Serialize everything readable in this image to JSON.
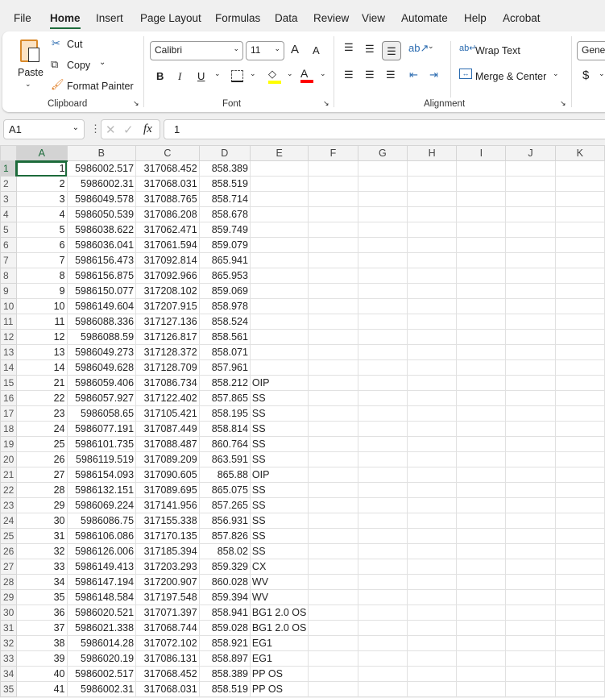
{
  "menu_tabs": [
    "File",
    "Home",
    "Insert",
    "Page Layout",
    "Formulas",
    "Data",
    "Review",
    "View",
    "Automate",
    "Help",
    "Acrobat"
  ],
  "active_tab": "Home",
  "clipboard": {
    "paste": "Paste",
    "cut": "Cut",
    "copy": "Copy",
    "format_painter": "Format Painter",
    "label": "Clipboard"
  },
  "font": {
    "name": "Calibri",
    "size": "11",
    "bold": "B",
    "italic": "I",
    "underline": "U",
    "label": "Font",
    "font_color_letter": "A",
    "grow": "A",
    "shrink": "A"
  },
  "alignment": {
    "wrap_text": "Wrap Text",
    "merge_center": "Merge & Center",
    "label": "Alignment"
  },
  "number": {
    "format": "Gener",
    "currency": "$"
  },
  "colors": {
    "accent": "#1d6b3b",
    "highlight": "#ffff00",
    "font_color": "#ff0000"
  },
  "formula_bar": {
    "name_box": "A1",
    "fx": "fx",
    "value": "1"
  },
  "columns": [
    "A",
    "B",
    "C",
    "D",
    "E",
    "F",
    "G",
    "H",
    "I",
    "J",
    "K"
  ],
  "rows": [
    [
      "1",
      "5986002.517",
      "317068.452",
      "858.389",
      ""
    ],
    [
      "2",
      "5986002.31",
      "317068.031",
      "858.519",
      ""
    ],
    [
      "3",
      "5986049.578",
      "317088.765",
      "858.714",
      ""
    ],
    [
      "4",
      "5986050.539",
      "317086.208",
      "858.678",
      ""
    ],
    [
      "5",
      "5986038.622",
      "317062.471",
      "859.749",
      ""
    ],
    [
      "6",
      "5986036.041",
      "317061.594",
      "859.079",
      ""
    ],
    [
      "7",
      "5986156.473",
      "317092.814",
      "865.941",
      ""
    ],
    [
      "8",
      "5986156.875",
      "317092.966",
      "865.953",
      ""
    ],
    [
      "9",
      "5986150.077",
      "317208.102",
      "859.069",
      ""
    ],
    [
      "10",
      "5986149.604",
      "317207.915",
      "858.978",
      ""
    ],
    [
      "11",
      "5986088.336",
      "317127.136",
      "858.524",
      ""
    ],
    [
      "12",
      "5986088.59",
      "317126.817",
      "858.561",
      ""
    ],
    [
      "13",
      "5986049.273",
      "317128.372",
      "858.071",
      ""
    ],
    [
      "14",
      "5986049.628",
      "317128.709",
      "857.961",
      ""
    ],
    [
      "21",
      "5986059.406",
      "317086.734",
      "858.212",
      "OIP"
    ],
    [
      "22",
      "5986057.927",
      "317122.402",
      "857.865",
      "SS"
    ],
    [
      "23",
      "5986058.65",
      "317105.421",
      "858.195",
      "SS"
    ],
    [
      "24",
      "5986077.191",
      "317087.449",
      "858.814",
      "SS"
    ],
    [
      "25",
      "5986101.735",
      "317088.487",
      "860.764",
      "SS"
    ],
    [
      "26",
      "5986119.519",
      "317089.209",
      "863.591",
      "SS"
    ],
    [
      "27",
      "5986154.093",
      "317090.605",
      "865.88",
      "OIP"
    ],
    [
      "28",
      "5986132.151",
      "317089.695",
      "865.075",
      "SS"
    ],
    [
      "29",
      "5986069.224",
      "317141.956",
      "857.265",
      "SS"
    ],
    [
      "30",
      "5986086.75",
      "317155.338",
      "856.931",
      "SS"
    ],
    [
      "31",
      "5986106.086",
      "317170.135",
      "857.826",
      "SS"
    ],
    [
      "32",
      "5986126.006",
      "317185.394",
      "858.02",
      "SS"
    ],
    [
      "33",
      "5986149.413",
      "317203.293",
      "859.329",
      "CX"
    ],
    [
      "34",
      "5986147.194",
      "317200.907",
      "860.028",
      "WV"
    ],
    [
      "35",
      "5986148.584",
      "317197.548",
      "859.394",
      "WV"
    ],
    [
      "36",
      "5986020.521",
      "317071.397",
      "858.941",
      "BG1 2.0 OS"
    ],
    [
      "37",
      "5986021.338",
      "317068.744",
      "859.028",
      "BG1 2.0 OS"
    ],
    [
      "38",
      "5986014.28",
      "317072.102",
      "858.921",
      "EG1"
    ],
    [
      "39",
      "5986020.19",
      "317086.131",
      "858.897",
      "EG1"
    ],
    [
      "40",
      "5986002.517",
      "317068.452",
      "858.389",
      "PP OS"
    ],
    [
      "41",
      "5986002.31",
      "317068.031",
      "858.519",
      "PP OS"
    ]
  ]
}
